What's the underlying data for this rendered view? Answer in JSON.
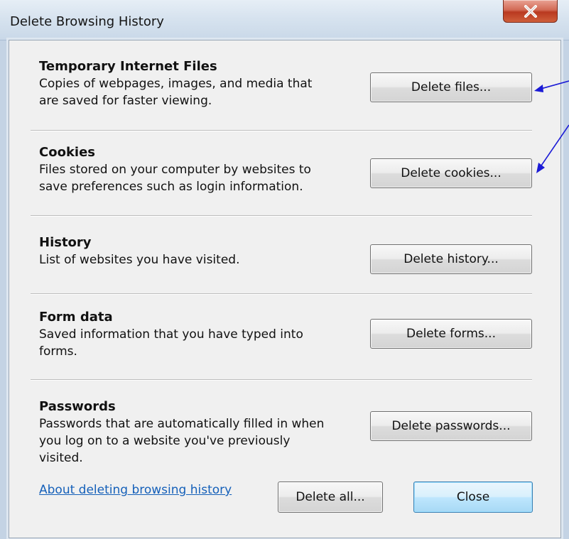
{
  "window": {
    "title": "Delete Browsing History",
    "close_icon": "close-x-icon"
  },
  "sections": [
    {
      "title": "Temporary Internet Files",
      "desc_lines": [
        "Copies of webpages, images, and media that",
        "are saved for faster viewing."
      ],
      "button": "Delete files..."
    },
    {
      "title": "Cookies",
      "desc_lines": [
        "Files stored on your computer by websites to",
        "save preferences such as login information."
      ],
      "button": "Delete cookies..."
    },
    {
      "title": "History",
      "desc_lines": [
        "List of websites you have visited."
      ],
      "button": "Delete history..."
    },
    {
      "title": "Form data",
      "desc_lines": [
        "Saved information that you have typed into",
        "forms."
      ],
      "button": "Delete forms..."
    },
    {
      "title": "Passwords",
      "desc_lines": [
        "Passwords that are automatically filled in when",
        "you log on to a website you've previously",
        "visited."
      ],
      "button": "Delete passwords..."
    }
  ],
  "footer": {
    "about_link": "About deleting browsing history",
    "delete_all": "Delete all...",
    "close": "Close"
  },
  "annotation_color": "#1b1bd6"
}
